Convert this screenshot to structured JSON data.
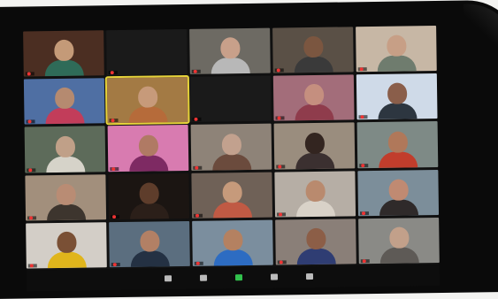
{
  "meeting": {
    "tiles": [
      {
        "name": "",
        "bg": "#4b2e22",
        "skin": "#c49a78",
        "shirt": "#2f6b58"
      },
      {
        "name": "",
        "text": "",
        "bg": "#1a1a1a"
      },
      {
        "name": "",
        "bg": "#6d6a63",
        "skin": "#c8a08a",
        "shirt": "#b8b8b8"
      },
      {
        "name": "",
        "bg": "#5a5046",
        "skin": "#7b5640",
        "shirt": "#3a3a3a"
      },
      {
        "name": "",
        "bg": "#c7b7a5",
        "skin": "#c79f86",
        "shirt": "#6f7c6e"
      },
      {
        "name": "",
        "bg": "#4f6fa3",
        "skin": "#b58a70",
        "shirt": "#c23d5a"
      },
      {
        "name": "",
        "bg": "#a37a44",
        "skin": "#c79a7a",
        "shirt": "#b66b3a",
        "active": true
      },
      {
        "name": "",
        "text": "",
        "bg": "#1a1a1a"
      },
      {
        "name": "",
        "bg": "#a36d7a",
        "skin": "#c58f7f",
        "shirt": "#8f3c4c"
      },
      {
        "name": "",
        "bg": "#cfdae8",
        "skin": "#8a5e4a",
        "shirt": "#2d3640"
      },
      {
        "name": "",
        "bg": "#5d6b5a",
        "skin": "#c0a088",
        "shirt": "#d6d3c9"
      },
      {
        "name": "",
        "bg": "#d87bb0",
        "skin": "#b07a64",
        "shirt": "#7e2a63"
      },
      {
        "name": "",
        "bg": "#8e8378",
        "skin": "#c2a18e",
        "shirt": "#6b4b3d"
      },
      {
        "name": "",
        "bg": "#9a8d7e",
        "skin": "#332520",
        "shirt": "#3b3030"
      },
      {
        "name": "",
        "bg": "#7e8a86",
        "skin": "#b0785a",
        "shirt": "#c13d2c"
      },
      {
        "name": "",
        "bg": "#a28f7c",
        "skin": "#b98c74",
        "shirt": "#3d352e"
      },
      {
        "name": "",
        "bg": "#1b1512",
        "skin": "#5e3d2b",
        "shirt": "#2b1f19"
      },
      {
        "name": "",
        "bg": "#6f6157",
        "skin": "#c69a7b",
        "shirt": "#c05a44"
      },
      {
        "name": "",
        "bg": "#b6aea5",
        "skin": "#b98a6e",
        "shirt": "#d9d2c8"
      },
      {
        "name": "",
        "bg": "#7c8e9a",
        "skin": "#c08a72",
        "shirt": "#2f2a2a"
      },
      {
        "name": "",
        "bg": "#d3cec7",
        "skin": "#7a5035",
        "shirt": "#e0b51c"
      },
      {
        "name": "",
        "bg": "#5b6e7f",
        "skin": "#b28065",
        "shirt": "#243143"
      },
      {
        "name": "",
        "bg": "#7b8e9e",
        "skin": "#b48161",
        "shirt": "#2d6cc2"
      },
      {
        "name": "",
        "bg": "#8a7f78",
        "skin": "#8c5e47",
        "shirt": "#2f3d73"
      },
      {
        "name": "",
        "bg": "#8a8a86",
        "skin": "#c2a08a",
        "shirt": "#5e5a56"
      }
    ]
  },
  "toolbar": {
    "items": [
      {
        "label": "",
        "icon": "participants-icon"
      },
      {
        "label": "",
        "icon": "chat-icon"
      },
      {
        "label": "",
        "icon": "share-screen-icon"
      },
      {
        "label": "",
        "icon": "record-icon"
      },
      {
        "label": "",
        "icon": "reactions-icon"
      }
    ]
  },
  "colors": {
    "active_speaker": "#e6d33a",
    "share_green": "#32c24d",
    "mic_muted": "#e33"
  }
}
